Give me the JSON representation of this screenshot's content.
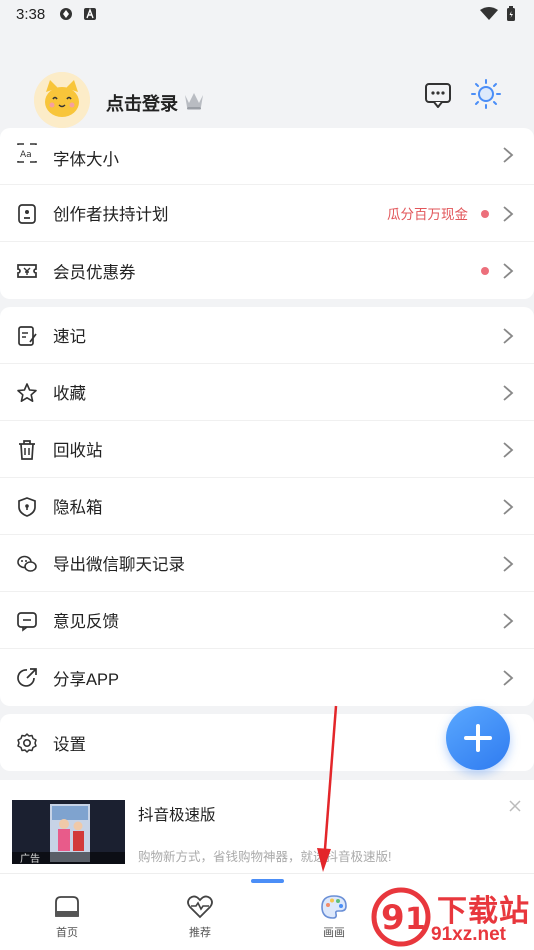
{
  "status": {
    "time": "3:38"
  },
  "header": {
    "login_label": "点击登录"
  },
  "settings_card": [
    {
      "label": "字体大小",
      "icon": "font-size-icon"
    },
    {
      "label": "创作者扶持计划",
      "icon": "creator-icon",
      "promo": "瓜分百万现金",
      "dot": true
    },
    {
      "label": "会员优惠券",
      "icon": "coupon-icon",
      "dot": true
    }
  ],
  "tools_card": [
    {
      "label": "速记",
      "icon": "note-icon"
    },
    {
      "label": "收藏",
      "icon": "star-icon"
    },
    {
      "label": "回收站",
      "icon": "trash-icon"
    },
    {
      "label": "隐私箱",
      "icon": "shield-icon"
    },
    {
      "label": "导出微信聊天记录",
      "icon": "wechat-icon"
    },
    {
      "label": "意见反馈",
      "icon": "feedback-icon"
    },
    {
      "label": "分享APP",
      "icon": "share-icon"
    }
  ],
  "settings_row": {
    "label": "设置",
    "icon": "gear-icon"
  },
  "ad": {
    "title": "抖音极速版",
    "description": "购物新方式，省钱购物神器，就选抖音极速版!",
    "tag": "广告"
  },
  "tabs": [
    {
      "label": "首页",
      "icon": "home-icon"
    },
    {
      "label": "推荐",
      "icon": "heart-pulse-icon"
    },
    {
      "label": "画画",
      "icon": "palette-icon",
      "active": true
    }
  ],
  "watermark": {
    "text": "下载站",
    "domain": "91xz.net"
  },
  "colors": {
    "accent": "#4b8ef7",
    "promo": "#e2565a",
    "dot": "#ec6f7b"
  }
}
